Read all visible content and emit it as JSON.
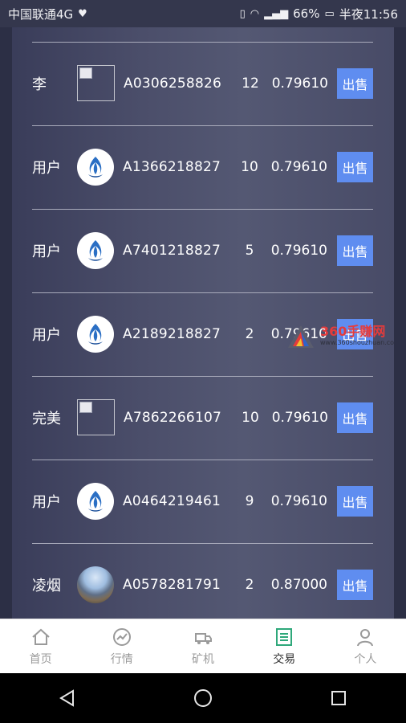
{
  "status": {
    "carrier": "中国联通4G",
    "battery": "66%",
    "time": "半夜11:56"
  },
  "rows": [
    {
      "name": "李",
      "avatar": "broken-image",
      "code": "A0306258826",
      "qty": "12",
      "price": "0.79610",
      "action": "出售"
    },
    {
      "name": "用户",
      "avatar": "logo",
      "code": "A1366218827",
      "qty": "10",
      "price": "0.79610",
      "action": "出售"
    },
    {
      "name": "用户",
      "avatar": "logo",
      "code": "A7401218827",
      "qty": "5",
      "price": "0.79610",
      "action": "出售"
    },
    {
      "name": "用户",
      "avatar": "logo",
      "code": "A2189218827",
      "qty": "2",
      "price": "0.79610",
      "action": "出售"
    },
    {
      "name": "完美",
      "avatar": "broken-image",
      "code": "A7862266107",
      "qty": "10",
      "price": "0.79610",
      "action": "出售"
    },
    {
      "name": "用户",
      "avatar": "logo",
      "code": "A0464219461",
      "qty": "9",
      "price": "0.79610",
      "action": "出售"
    },
    {
      "name": "凌烟",
      "avatar": "photo",
      "code": "A0578281791",
      "qty": "2",
      "price": "0.87000",
      "action": "出售"
    }
  ],
  "watermark": {
    "title": "360手赚网",
    "url": "www.360shouzhuan.com"
  },
  "tabs": [
    {
      "label": "首页",
      "icon": "home-icon",
      "active": false
    },
    {
      "label": "行情",
      "icon": "market-icon",
      "active": false
    },
    {
      "label": "矿机",
      "icon": "miner-icon",
      "active": false
    },
    {
      "label": "交易",
      "icon": "trade-icon",
      "active": true
    },
    {
      "label": "个人",
      "icon": "user-icon",
      "active": false
    }
  ],
  "colors": {
    "accent": "#5f8df0",
    "active_tab": "#2ea87a"
  }
}
